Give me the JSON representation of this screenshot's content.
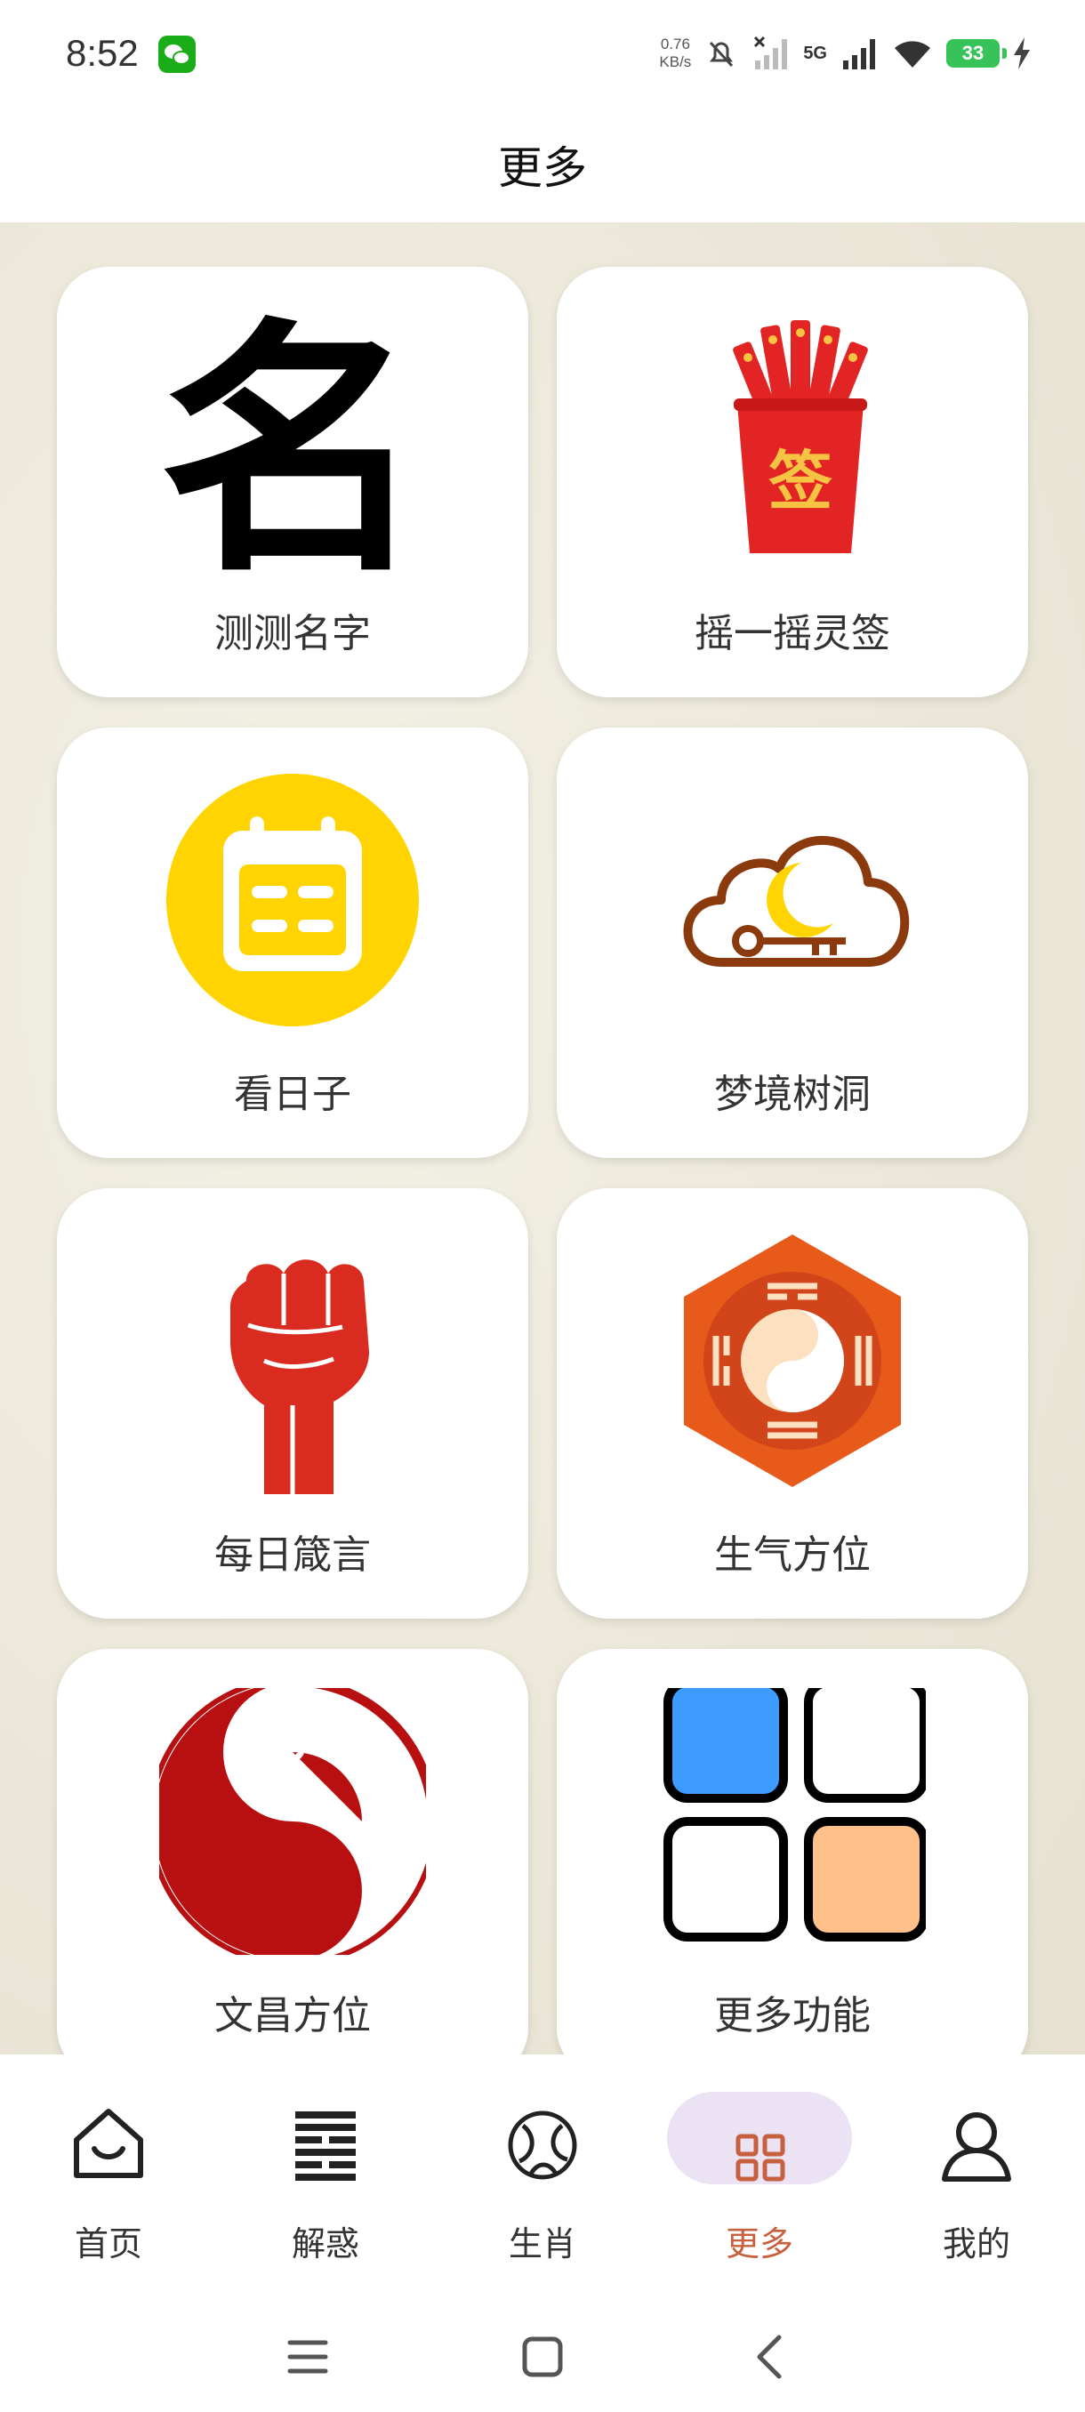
{
  "status_bar": {
    "time": "8:52",
    "net_speed_value": "0.76",
    "net_speed_unit": "KB/s",
    "network": "5G",
    "battery": "33"
  },
  "header": {
    "title": "更多"
  },
  "cards": [
    {
      "label": "测测名字",
      "icon": "name-character-icon",
      "glyph": "名"
    },
    {
      "label": "摇一摇灵签",
      "icon": "fortune-stick-cup-icon",
      "glyph": "签"
    },
    {
      "label": "看日子",
      "icon": "calendar-icon"
    },
    {
      "label": "梦境树洞",
      "icon": "dream-cloud-moon-key-icon"
    },
    {
      "label": "每日箴言",
      "icon": "raised-fist-icon"
    },
    {
      "label": "生气方位",
      "icon": "bagua-yinyang-icon"
    },
    {
      "label": "文昌方位",
      "icon": "red-yinyang-seal-icon"
    },
    {
      "label": "更多功能",
      "icon": "four-squares-icon"
    }
  ],
  "bottom_nav": {
    "items": [
      {
        "label": "首页",
        "icon": "home-icon"
      },
      {
        "label": "解惑",
        "icon": "hexagram-lines-icon"
      },
      {
        "label": "生肖",
        "icon": "zodiac-circle-icon"
      },
      {
        "label": "更多",
        "icon": "grid-apps-icon",
        "active": true
      },
      {
        "label": "我的",
        "icon": "person-icon"
      }
    ]
  },
  "colors": {
    "accent_active": "#c7603e",
    "active_pill": "#ebe2f4",
    "fortune_red": "#e32424",
    "calendar_yellow": "#ffd400",
    "dream_brown": "#8b3a0e",
    "fist_red": "#d92b1f",
    "bagua_orange": "#e85a1a",
    "seal_red": "#b81010",
    "square_blue": "#3d9bff",
    "square_peach": "#ffc089"
  }
}
